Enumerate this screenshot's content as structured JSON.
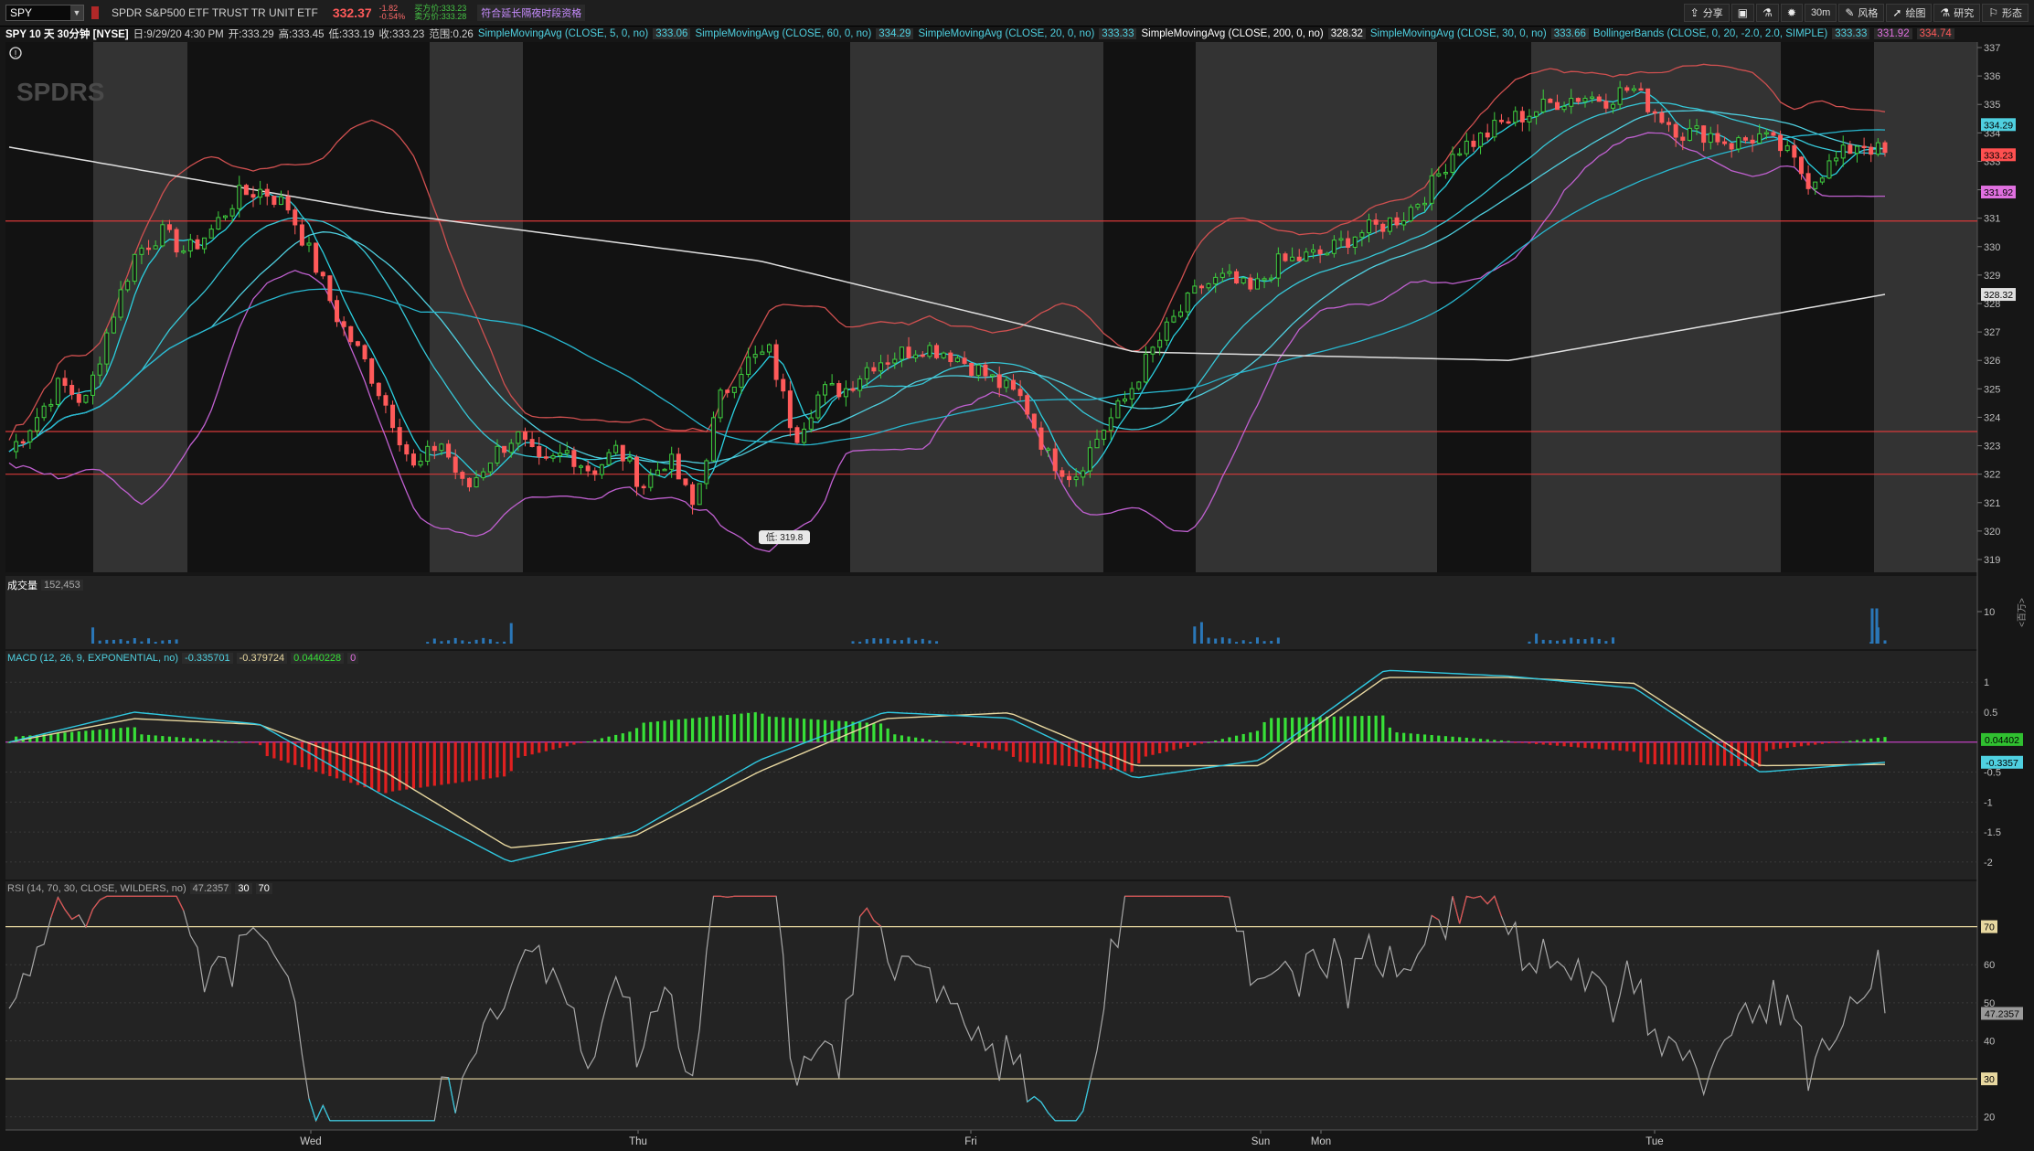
{
  "toolbar": {
    "symbol": "SPY",
    "description": "SPDR S&P500 ETF TRUST TR UNIT ETF",
    "last": "332.37",
    "change": "-1.82",
    "change_pct": "-0.54%",
    "bid": "买方价:333.23",
    "ask": "卖方价:333.28",
    "extended_label": "符合延长隔夜时段资格",
    "buttons": [
      {
        "icon": "share-icon",
        "label": "分享"
      },
      {
        "icon": "layout-icon",
        "label": ""
      },
      {
        "icon": "flask-icon",
        "label": ""
      },
      {
        "icon": "gear-icon",
        "label": ""
      },
      {
        "icon": "",
        "label": "30m"
      },
      {
        "icon": "style-icon",
        "label": "风格"
      },
      {
        "icon": "draw-icon",
        "label": "绘图"
      },
      {
        "icon": "study-icon",
        "label": "研究"
      },
      {
        "icon": "pattern-icon",
        "label": "形态"
      }
    ]
  },
  "study_bar": {
    "title": "SPY 10 天 30分钟 [NYSE]",
    "date": "日:9/29/20 4:30 PM",
    "open": "开:333.29",
    "high": "高:333.45",
    "low": "低:333.19",
    "close": "收:333.23",
    "range": "范围:0.26",
    "studies": [
      {
        "name": "SimpleMovingAvg (CLOSE, 5, 0, no)",
        "value": "333.06",
        "color": "#4fd0e0"
      },
      {
        "name": "SimpleMovingAvg (CLOSE, 60, 0, no)",
        "value": "334.29",
        "color": "#4fd0e0"
      },
      {
        "name": "SimpleMovingAvg (CLOSE, 20, 0, no)",
        "value": "333.33",
        "color": "#4fd0e0"
      },
      {
        "name": "SimpleMovingAvg (CLOSE, 200, 0, no)",
        "value": "328.32",
        "color": "#e0e0e0"
      },
      {
        "name": "SimpleMovingAvg (CLOSE, 30, 0, no)",
        "value": "333.66",
        "color": "#4fd0e0"
      }
    ],
    "bollinger": {
      "name": "BollingerBands (CLOSE, 0, 20, -2.0, 2.0, SIMPLE)",
      "mid": "333.33",
      "lower": "331.92",
      "upper": "334.74"
    }
  },
  "watermark": "SPDRS",
  "price_axis": {
    "ticks": [
      "319",
      "320",
      "321",
      "322",
      "323",
      "324",
      "325",
      "326",
      "327",
      "328",
      "329",
      "330",
      "331",
      "332",
      "333",
      "334",
      "335",
      "336",
      "337"
    ],
    "badges": [
      {
        "text": "334.29",
        "color": "#4fd0e0"
      },
      {
        "text": "333.23",
        "color": "#ff5050"
      },
      {
        "text": "331.92",
        "color": "#e070e0"
      },
      {
        "text": "328.32",
        "color": "#e0e0e0"
      }
    ],
    "low_callout": "低: 319.8"
  },
  "day_labels": [
    "Wed",
    "Thu",
    "Fri",
    "Sun",
    "Mon",
    "Tue"
  ],
  "volume_panel": {
    "label": "成交量",
    "value": "152,453",
    "ticks": [
      "10"
    ],
    "unit": "<百万>"
  },
  "macd_panel": {
    "label": "MACD (12, 26, 9, EXPONENTIAL, no)",
    "values": [
      {
        "text": "-0.335701",
        "color": "#4fd0e0"
      },
      {
        "text": "-0.379724",
        "color": "#e8d8a0"
      },
      {
        "text": "0.0440228",
        "color": "#38e038"
      },
      {
        "text": "0",
        "color": "#e070e0"
      }
    ],
    "ticks": [
      "1",
      "0.5",
      "-0.5",
      "-1",
      "-1.5",
      "-2"
    ],
    "badges": [
      {
        "text": "0.04402",
        "color": "#30c030"
      },
      {
        "text": "-0.3357",
        "color": "#4fd0e0"
      }
    ]
  },
  "rsi_panel": {
    "label": "RSI (14, 70, 30, CLOSE, WILDERS, no)",
    "values": [
      {
        "text": "47.2357"
      },
      {
        "text": "30"
      },
      {
        "text": "70"
      }
    ],
    "ticks": [
      "70",
      "60",
      "50",
      "40",
      "30",
      "20"
    ],
    "badges": [
      {
        "text": "47.2357",
        "color": "#9a9a9a"
      }
    ]
  },
  "chart_data": {
    "type": "candlestick",
    "title": "SPY 10 天 30分钟 [NYSE]",
    "ylim": [
      319,
      337
    ],
    "x": [
      "Wed",
      "Thu",
      "Fri",
      "Sun",
      "Mon",
      "Tue"
    ],
    "horizontal_lines": [
      330.9,
      323.5,
      322.0
    ],
    "close_path": [
      322.8,
      323.9,
      325.2,
      324.5,
      327.4,
      329.8,
      330.5,
      329.8,
      330.6,
      331.8,
      332.0,
      331.4,
      329.5,
      327.4,
      326.0,
      324.2,
      322.1,
      323.2,
      321.4,
      322.6,
      323.4,
      322.2,
      322.8,
      322.1,
      322.9,
      321.6,
      322.6,
      320.8,
      324.6,
      325.9,
      326.3,
      323.3,
      324.9,
      325.0,
      325.9,
      326.2,
      326.5,
      326.3,
      325.8,
      325.2,
      324.6,
      322.6,
      321.9,
      323.4,
      324.6,
      326.2,
      327.5,
      328.6,
      328.9,
      328.4,
      329.4,
      329.6,
      329.8,
      330.4,
      330.7,
      331.1,
      332.0,
      333.4,
      333.8,
      334.4,
      334.7,
      335.1,
      335.3,
      335.2,
      335.6,
      334.7,
      334.0,
      334.0,
      333.6,
      333.9,
      333.4,
      332.3,
      333.0,
      333.7,
      333.23
    ],
    "sma200_path": [
      333.5,
      331.2,
      329.5,
      326.3,
      326.0,
      328.32
    ],
    "volume_note": "volume bars in millions, axis tick 10",
    "macd": {
      "ylim": [
        -2.2,
        1.4
      ],
      "macd_path": [
        0.0,
        0.5,
        0.3,
        -0.9,
        -2.0,
        -1.5,
        -0.3,
        0.5,
        0.4,
        -0.6,
        -0.3,
        1.2,
        1.1,
        0.9,
        -0.5,
        -0.335701
      ],
      "signal_path": [
        0.0,
        0.4,
        0.3,
        -0.5,
        -1.8,
        -1.6,
        -0.5,
        0.4,
        0.5,
        -0.4,
        -0.4,
        1.1,
        1.1,
        1.0,
        -0.4,
        -0.379724
      ]
    },
    "rsi": {
      "ylim": [
        18,
        80
      ],
      "overbought": 70,
      "oversold": 30,
      "last": 47.2357
    }
  }
}
